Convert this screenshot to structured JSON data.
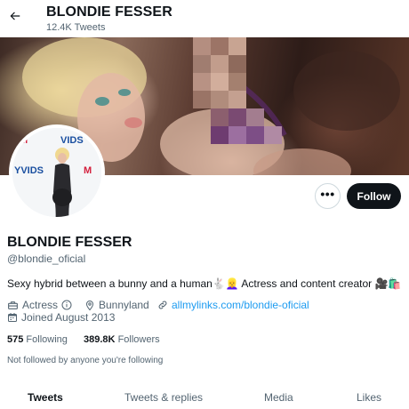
{
  "header": {
    "title": "BLONDIE FESSER",
    "tweet_count": "12.4K Tweets",
    "back_icon": "arrow-left-icon"
  },
  "avatar": {
    "brand_lines": [
      "M",
      "VIDS",
      "YVIDS",
      "M"
    ]
  },
  "actions": {
    "follow_label": "Follow",
    "more_label": "•••"
  },
  "profile": {
    "name": "BLONDIE FESSER",
    "handle": "@blondie_oficial",
    "bio": "Sexy hybrid between a bunny and a human🐇👱‍♀️ Actress and content creator 🎥🛍️",
    "category": "Actress",
    "location": "Bunnyland",
    "link": "allmylinks.com/blondie-oficial",
    "joined": "Joined August 2013"
  },
  "stats": {
    "following_count": "575",
    "following_label": "Following",
    "followers_count": "389.8K",
    "followers_label": "Followers"
  },
  "notice": "Not followed by anyone you're following",
  "tabs": [
    {
      "label": "Tweets",
      "active": true
    },
    {
      "label": "Tweets & replies",
      "active": false
    },
    {
      "label": "Media",
      "active": false
    },
    {
      "label": "Likes",
      "active": false
    }
  ],
  "colors": {
    "accent": "#1d9bf0",
    "text": "#0f1419",
    "muted": "#536471",
    "button": "#0f1419"
  }
}
